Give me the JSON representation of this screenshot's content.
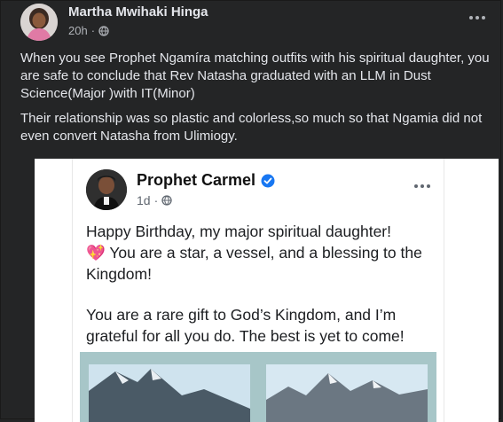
{
  "outer_post": {
    "author": "Martha Mwihaki Hinga",
    "time": "20h",
    "paragraphs": [
      "When you see Prophet Ngamíra matching outfits with his spiritual daughter, you are safe to conclude that Rev Natasha graduated with an LLM in Dust Science(Major )with IT(Minor)",
      "Their relationship was so plastic and colorless,so much so that Ngamia did not even convert Natasha from Ulimiogy."
    ]
  },
  "shared_post": {
    "author": "Prophet Carmel",
    "time": "1d",
    "line1": "Happy Birthday, my major  spiritual daughter!",
    "heart": "💖",
    "line2": " You are a star, a vessel, and a blessing to the Kingdom!",
    "line3": "You are a rare gift to God’s Kingdom, and I’m grateful for all you do. The best is yet to come!"
  },
  "icons": {
    "more": "more-options-icon",
    "globe": "globe-icon",
    "verified": "verified-badge-icon"
  },
  "colors": {
    "background": "#242526",
    "text_primary": "#e4e6eb",
    "text_secondary": "#b0b3b8",
    "verified_blue": "#1877f2"
  }
}
